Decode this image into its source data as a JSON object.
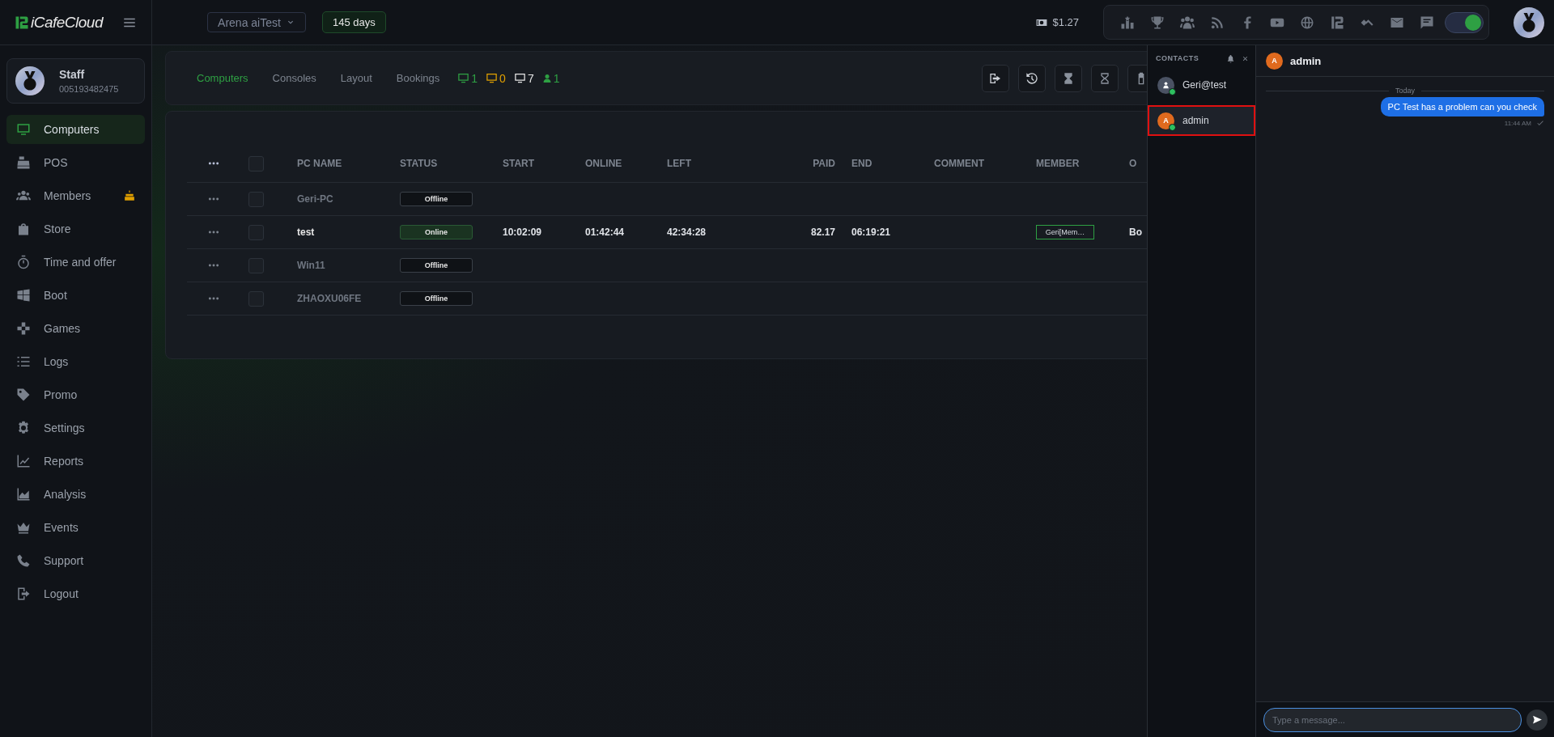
{
  "app": {
    "name": "iCafeCloud"
  },
  "topbar": {
    "branch": "Arena aiTest",
    "license": "145 days",
    "balance": "$1.27",
    "toggle": {
      "on": true
    }
  },
  "profile": {
    "role": "Staff",
    "id": "005193482475"
  },
  "sidebar": {
    "items": [
      {
        "label": "Computers",
        "selected": true,
        "alert": false
      },
      {
        "label": "POS",
        "selected": false,
        "alert": false
      },
      {
        "label": "Members",
        "selected": false,
        "alert": true
      },
      {
        "label": "Store",
        "selected": false,
        "alert": false
      },
      {
        "label": "Time and offer",
        "selected": false,
        "alert": false
      },
      {
        "label": "Boot",
        "selected": false,
        "alert": false
      },
      {
        "label": "Games",
        "selected": false,
        "alert": false
      },
      {
        "label": "Logs",
        "selected": false,
        "alert": false
      },
      {
        "label": "Promo",
        "selected": false,
        "alert": false
      },
      {
        "label": "Settings",
        "selected": false,
        "alert": false
      },
      {
        "label": "Reports",
        "selected": false,
        "alert": false
      },
      {
        "label": "Analysis",
        "selected": false,
        "alert": false
      },
      {
        "label": "Events",
        "selected": false,
        "alert": false
      },
      {
        "label": "Support",
        "selected": false,
        "alert": false
      },
      {
        "label": "Logout",
        "selected": false,
        "alert": false
      }
    ]
  },
  "tabs": [
    {
      "label": "Computers",
      "selected": true
    },
    {
      "label": "Consoles",
      "selected": false
    },
    {
      "label": "Layout",
      "selected": false
    },
    {
      "label": "Bookings",
      "selected": false
    }
  ],
  "counters": [
    {
      "kind": "monitor",
      "value": "1",
      "color": "#2ea043"
    },
    {
      "kind": "monitor",
      "value": "0",
      "color": "#e0a000"
    },
    {
      "kind": "monitor",
      "value": "7",
      "color": "#e6e6e6"
    },
    {
      "kind": "person",
      "value": "1",
      "color": "#2ea043"
    }
  ],
  "table": {
    "all_checked": false,
    "columns": [
      "PC NAME",
      "STATUS",
      "START",
      "ONLINE",
      "LEFT",
      "PAID",
      "END",
      "COMMENT",
      "MEMBER",
      "O"
    ],
    "rows": [
      {
        "pc_name": "Geri-PC",
        "status": "Offline",
        "online": false,
        "checked": false
      },
      {
        "pc_name": "test",
        "status": "Online",
        "online": true,
        "checked": false,
        "start": "10:02:09",
        "online_time": "01:42:44",
        "left": "42:34:28",
        "paid": "82.17",
        "end": "06:19:21",
        "member": "Geri[Mem…",
        "column_10": "Bo"
      },
      {
        "pc_name": "Win11",
        "status": "Offline",
        "online": false,
        "checked": false
      },
      {
        "pc_name": "ZHAOXU06FE",
        "status": "Offline",
        "online": false,
        "checked": false
      }
    ]
  },
  "chat": {
    "contacts_title": "CONTACTS",
    "contacts": [
      {
        "kind": "user",
        "name": "Geri@test",
        "online": true,
        "selected": false
      },
      {
        "kind": "letter",
        "initial": "A",
        "name": "admin",
        "online": true,
        "selected": true
      }
    ],
    "conversation": {
      "initial": "A",
      "title": "admin",
      "divider": "Today",
      "messages": [
        {
          "text": "PC Test has a problem can you check",
          "time": "11:44 AM",
          "read": true
        }
      ]
    },
    "input": {
      "placeholder": "Type a message..."
    }
  }
}
